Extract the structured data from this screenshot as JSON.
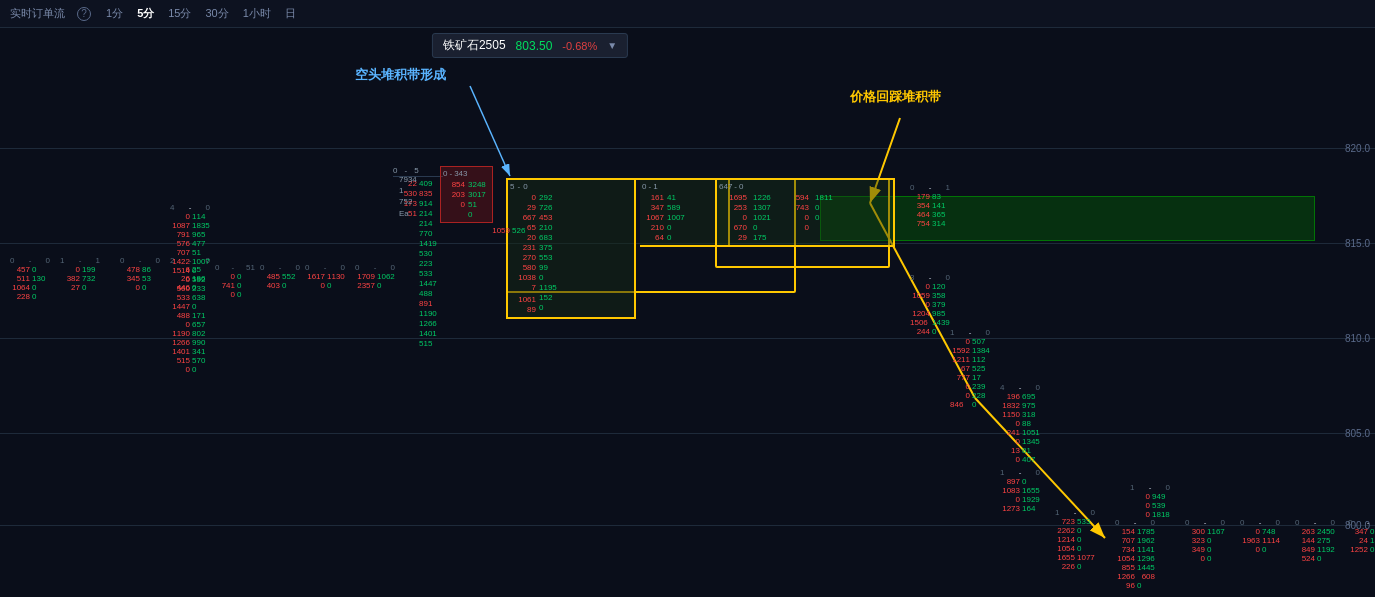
{
  "header": {
    "title": "实时订单流",
    "info_label": "?",
    "timeframes": [
      "1分",
      "5分",
      "15分",
      "30分",
      "1小时",
      "日"
    ],
    "active_timeframe": "5分"
  },
  "instrument": {
    "name": "铁矿石2505",
    "price": "803.50",
    "change": "-0.68%"
  },
  "annotations": {
    "bearish_label": "空头堆积带形成",
    "price_retest_label": "价格回踩堆积带"
  },
  "price_levels": [
    "820.0",
    "815.0",
    "810.0",
    "805.0",
    "800.0"
  ],
  "colors": {
    "background": "#0a0e1a",
    "sell": "#ff4444",
    "buy": "#00cc66",
    "annotation_blue": "#5ab4ff",
    "annotation_yellow": "#ffc800",
    "green_band": "rgba(0,100,0,0.4)"
  }
}
